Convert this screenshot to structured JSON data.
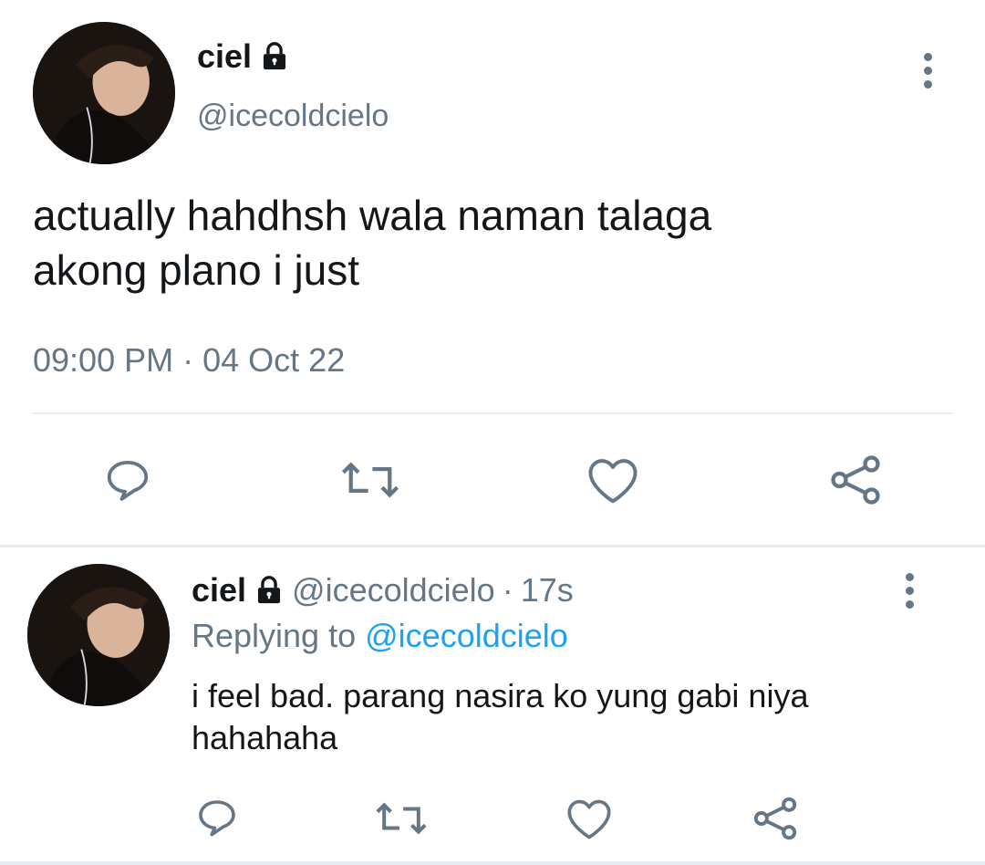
{
  "main_tweet": {
    "display_name": "ciel",
    "handle": "@icecoldcielo",
    "text_line1": "actually hahdhsh wala naman talaga",
    "text_line2": "akong plano i just",
    "time": "09:00 PM",
    "dot": "·",
    "date": "04 Oct 22"
  },
  "reply_tweet": {
    "display_name": "ciel",
    "handle": "@icecoldcielo",
    "dot": "·",
    "age": "17s",
    "replying_prefix": "Replying to",
    "replying_handle": "@icecoldcielo",
    "text_line1": "i feel bad. parang nasira ko yung gabi niya",
    "text_line2": "hahahaha"
  },
  "icons": {
    "lock": "lock-icon",
    "more": "more-vertical-icon",
    "reply": "reply-icon",
    "retweet": "retweet-icon",
    "like": "heart-icon",
    "share": "share-icon"
  },
  "colors": {
    "text": "#14171a",
    "muted": "#657786",
    "link": "#1da1f2",
    "divider": "#e6ecf0"
  }
}
